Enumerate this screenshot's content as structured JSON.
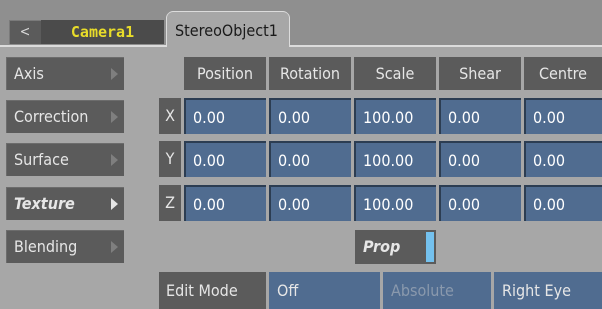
{
  "tabs": {
    "back_label": "<",
    "camera_label": "Camera1",
    "stereo_label": "StereoObject1"
  },
  "sidebar": {
    "items": [
      {
        "label": "Axis"
      },
      {
        "label": "Correction"
      },
      {
        "label": "Surface"
      },
      {
        "label": "Texture",
        "active": true
      },
      {
        "label": "Blending"
      }
    ]
  },
  "table": {
    "columns": [
      "Position",
      "Rotation",
      "Scale",
      "Shear",
      "Centre"
    ],
    "rows": [
      {
        "label": "X",
        "values": [
          "0.00",
          "0.00",
          "100.00",
          "0.00",
          "0.00"
        ]
      },
      {
        "label": "Y",
        "values": [
          "0.00",
          "0.00",
          "100.00",
          "0.00",
          "0.00"
        ]
      },
      {
        "label": "Z",
        "values": [
          "0.00",
          "0.00",
          "100.00",
          "0.00",
          "0.00"
        ]
      }
    ]
  },
  "prop": {
    "label": "Prop",
    "enabled": true
  },
  "edit_mode": {
    "label": "Edit Mode",
    "options": [
      "Off",
      "Absolute",
      "Right Eye"
    ]
  },
  "colors": {
    "background": "#a7a7a7",
    "field": "#506c90",
    "button": "#5b5b5b",
    "camera_text": "#e8dc2a",
    "indicator": "#74c1ee"
  }
}
